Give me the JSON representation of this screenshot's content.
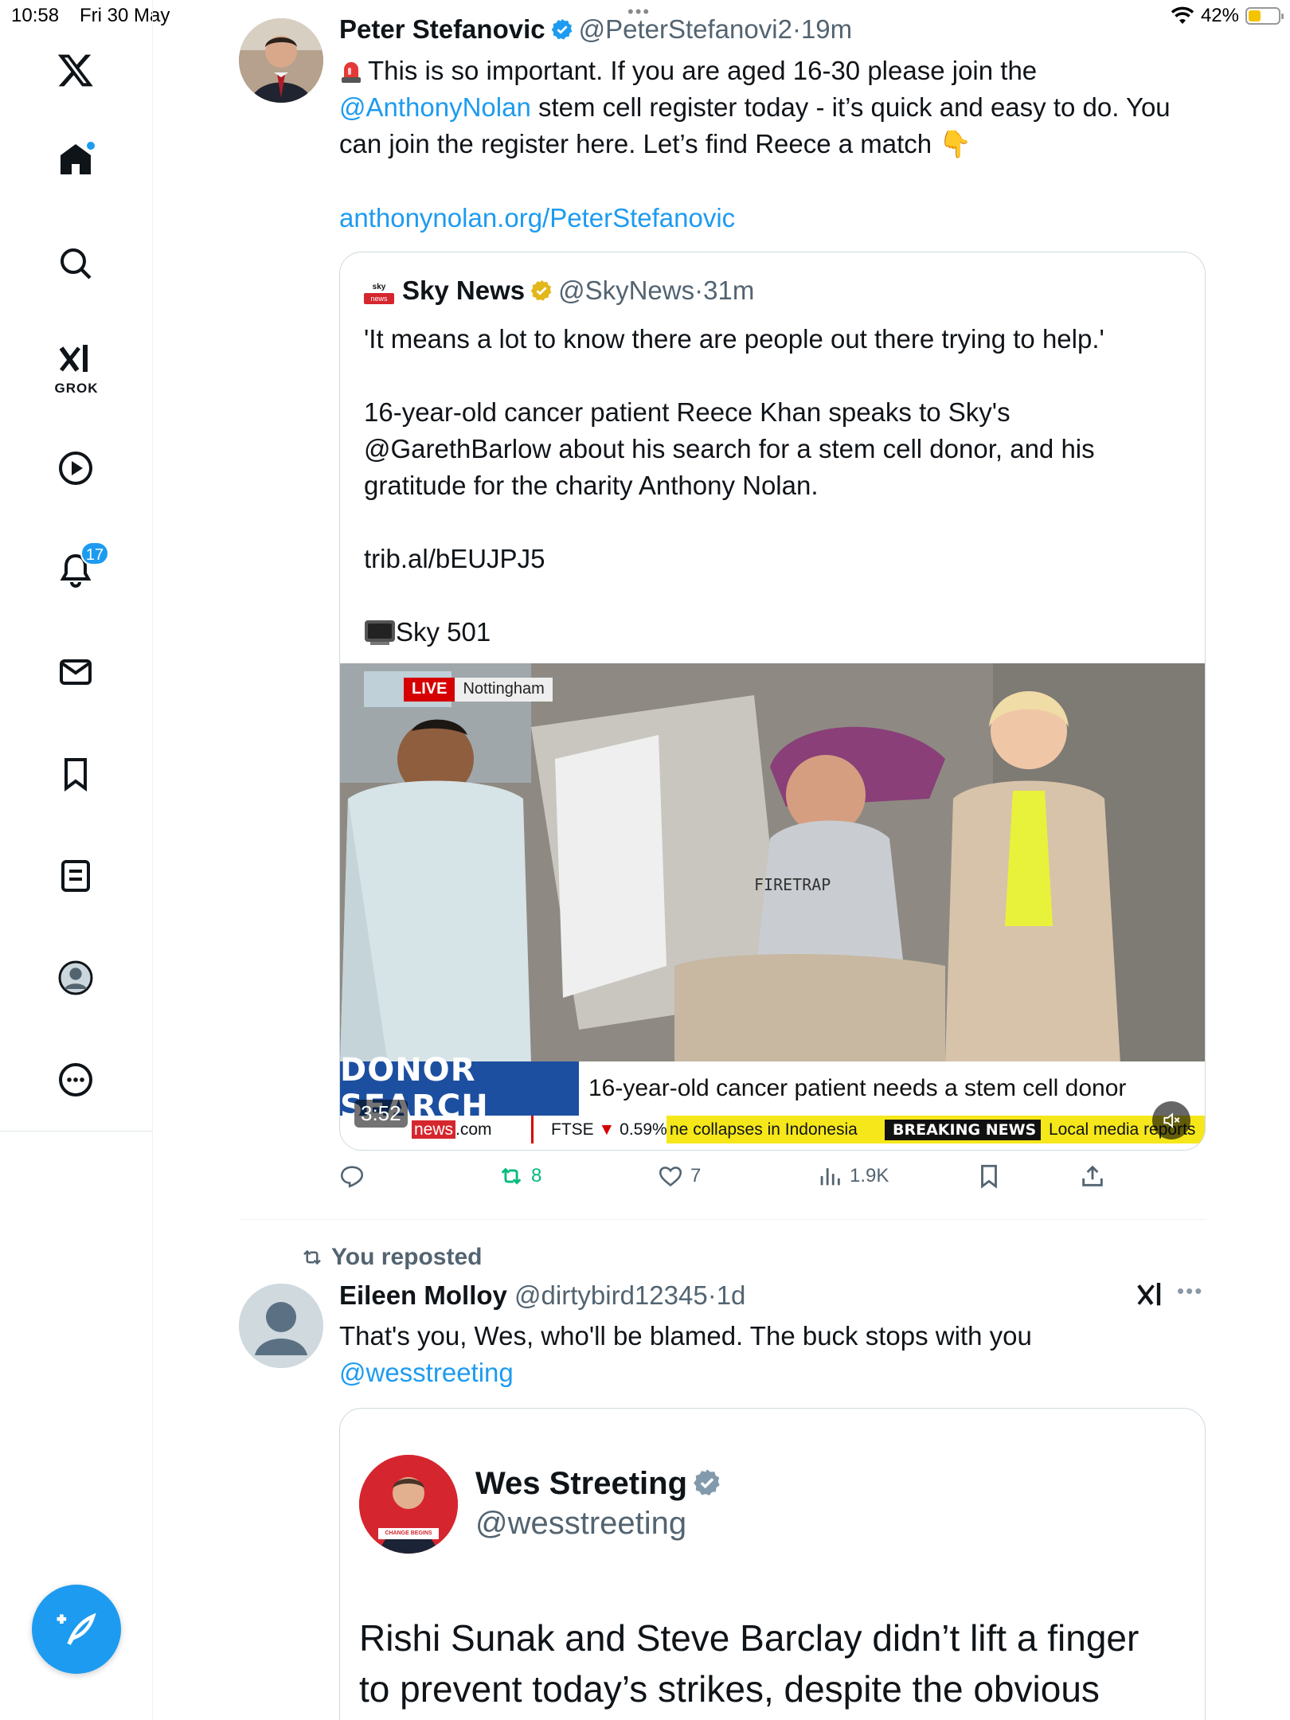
{
  "status_bar": {
    "time": "10:58",
    "date": "Fri 30 May",
    "battery": "42%",
    "battery_level": 0.42
  },
  "sidebar": {
    "notifications_count": "17",
    "grok_label": "GROK"
  },
  "tweets": [
    {
      "author_name": "Peter Stefanovic",
      "author_handle": "@PeterStefanovi2",
      "separator": "·",
      "time": "19m",
      "text_line1": "This is so important. If you are aged 16-30 please join the",
      "text_mention": "@AnthonyNolan",
      "text_line2": " stem cell register today - it’s quick and easy to do. You",
      "text_line3": "can join the register here. Let’s find Reece a match",
      "emoji_point": "👇",
      "link": "anthonynolan.org/PeterStefanovic",
      "quote": {
        "author_name": "Sky News",
        "author_handle": "@SkyNews",
        "time": "31m",
        "logo_text_top": "sky",
        "logo_text_bottom": "news",
        "text_p1": "'It means a lot to know there are people out there trying to help.'",
        "text_p2_l1": "16-year-old cancer patient Reece Khan speaks to Sky's",
        "text_p2_l2": "@GarethBarlow about his search for a stem cell donor, and his",
        "text_p2_l3": "gratitude for the charity Anthony Nolan.",
        "text_link": "trib.al/bEUJPJ5",
        "text_channel": "Sky 501",
        "video": {
          "live_label": "LIVE",
          "location": "Nottingham",
          "shirt_text": "FIRETRAP",
          "strap_title": "DONOR SEARCH",
          "strap_text": "16-year-old cancer patient needs a stem cell donor",
          "ticker_site_a": "news",
          "ticker_site_b": ".com",
          "ticker_ftse": "FTSE",
          "ticker_ftse_change": "0.59%",
          "ticker_story": "ne collapses in Indonesia",
          "ticker_breaking": "BREAKING NEWS",
          "ticker_local": "Local media reports",
          "duration": "3:52"
        }
      },
      "actions": {
        "retweets": "8",
        "likes": "7",
        "views": "1.9K"
      }
    },
    {
      "repost_label": "You reposted",
      "author_name": "Eileen Molloy",
      "author_handle": "@dirtybird12345",
      "separator": "·",
      "time": "1d",
      "text_line1": "That's you, Wes, who'll be blamed. The buck stops with you",
      "text_mention": "@wesstreeting",
      "quote": {
        "author_name": "Wes Streeting",
        "author_handle": "@wesstreeting",
        "avatar_caption": "CHANGE BEGINS",
        "text_l1": "Rishi Sunak and Steve Barclay didn’t lift a finger",
        "text_l2": "to prevent today’s strikes, despite the obvious"
      }
    }
  ]
}
